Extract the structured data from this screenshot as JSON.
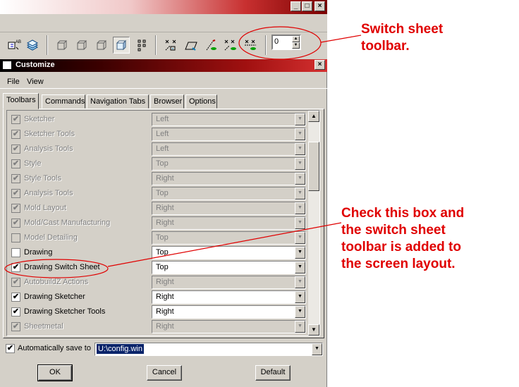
{
  "window": {
    "buttons": {
      "minimize": "_",
      "maximize": "□",
      "close": "×"
    }
  },
  "toolbar": {
    "spinner_value": "0",
    "icons": [
      "layer-select-icon",
      "layers-icon",
      "view-box-icon-1",
      "view-box-icon-2",
      "view-box-icon-3",
      "view-box-icon-4",
      "grid-points-icon",
      "sketch-x-icon",
      "sketch-plane-icon",
      "sketch-line-icon",
      "sketch-xx-icon",
      "sketch-xy-icon"
    ]
  },
  "dialog": {
    "title": "Customize",
    "close": "×"
  },
  "menubar": {
    "file": "File",
    "view": "View"
  },
  "tabs": [
    {
      "label": "Toolbars",
      "active": true
    },
    {
      "label": "Commands",
      "active": false
    },
    {
      "label": "Navigation Tabs",
      "active": false
    },
    {
      "label": "Browser",
      "active": false
    },
    {
      "label": "Options",
      "active": false
    }
  ],
  "toolbars": [
    {
      "label": "Sketcher",
      "position": "Left",
      "checked": true,
      "enabled": false
    },
    {
      "label": "Sketcher Tools",
      "position": "Left",
      "checked": true,
      "enabled": false
    },
    {
      "label": "Analysis Tools",
      "position": "Left",
      "checked": true,
      "enabled": false
    },
    {
      "label": "Style",
      "position": "Top",
      "checked": true,
      "enabled": false
    },
    {
      "label": "Style Tools",
      "position": "Right",
      "checked": true,
      "enabled": false
    },
    {
      "label": "Analysis Tools",
      "position": "Top",
      "checked": true,
      "enabled": false
    },
    {
      "label": "Mold Layout",
      "position": "Right",
      "checked": true,
      "enabled": false
    },
    {
      "label": "Mold/Cast Manufacturing",
      "position": "Right",
      "checked": true,
      "enabled": false
    },
    {
      "label": "Model Detailing",
      "position": "Top",
      "checked": false,
      "enabled": false
    },
    {
      "label": "Drawing",
      "position": "Top",
      "checked": false,
      "enabled": true
    },
    {
      "label": "Drawing Switch Sheet",
      "position": "Top",
      "checked": true,
      "enabled": true
    },
    {
      "label": "AutobuildZ Actions",
      "position": "Right",
      "checked": true,
      "enabled": false
    },
    {
      "label": "Drawing Sketcher",
      "position": "Right",
      "checked": true,
      "enabled": true
    },
    {
      "label": "Drawing Sketcher Tools",
      "position": "Right",
      "checked": true,
      "enabled": true
    },
    {
      "label": "Sheetmetal",
      "position": "Right",
      "checked": true,
      "enabled": false
    }
  ],
  "autosave": {
    "label": "Automatically save to",
    "path": "U:\\config.win",
    "checked": true
  },
  "buttons": {
    "ok": "OK",
    "cancel": "Cancel",
    "default": "Default"
  },
  "annotations": {
    "switch_sheet": [
      "Switch sheet",
      "toolbar."
    ],
    "check_box": [
      "Check this box and",
      "the switch sheet",
      "toolbar is added to",
      "the screen layout."
    ]
  },
  "colors": {
    "annotation": "#e00000",
    "dialog_face": "#d4d0c8",
    "selection": "#0a246a"
  }
}
